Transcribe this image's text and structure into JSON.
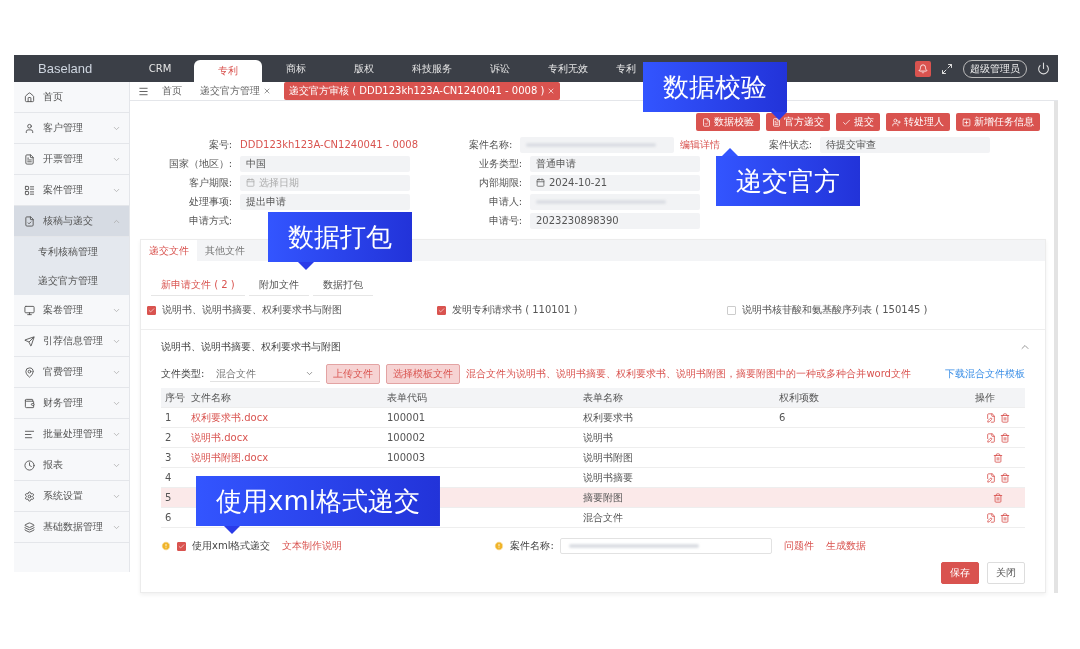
{
  "top_bar": {
    "logo": "Baseland",
    "nav": [
      {
        "label": "CRM",
        "selected": false
      },
      {
        "label": "专利",
        "selected": true
      },
      {
        "label": "商标",
        "selected": false
      },
      {
        "label": "版权",
        "selected": false
      },
      {
        "label": "科技服务",
        "selected": false
      },
      {
        "label": "诉讼",
        "selected": false
      },
      {
        "label": "专利无效",
        "selected": false
      },
      {
        "label": "专利",
        "selected": false
      }
    ],
    "user": "超级管理员"
  },
  "breadcrumbs": [
    {
      "label": "首页",
      "selected": false,
      "closable": false
    },
    {
      "label": "递交官方管理",
      "selected": false,
      "closable": true
    },
    {
      "label": "递交官方审核 ( DDD123kh123A-CN1240041 - 0008 )",
      "selected": true,
      "closable": true
    }
  ],
  "sidebar": {
    "items": [
      {
        "label": "首页",
        "kind": "link",
        "selected": false
      },
      {
        "label": "客户管理",
        "kind": "group",
        "selected": false,
        "expanded": false
      },
      {
        "label": "开票管理",
        "kind": "group",
        "selected": false,
        "expanded": false
      },
      {
        "label": "案件管理",
        "kind": "group",
        "selected": false,
        "expanded": false
      },
      {
        "label": "核稿与递交",
        "kind": "group",
        "selected": true,
        "expanded": true,
        "children": [
          {
            "label": "专利核稿管理",
            "selected": false
          },
          {
            "label": "递交官方管理",
            "selected": false
          }
        ]
      },
      {
        "label": "案卷管理",
        "kind": "group",
        "selected": false,
        "expanded": false
      },
      {
        "label": "引荐信息管理",
        "kind": "group",
        "selected": false,
        "expanded": false
      },
      {
        "label": "官费管理",
        "kind": "group",
        "selected": false,
        "expanded": false
      },
      {
        "label": "财务管理",
        "kind": "group",
        "selected": false,
        "expanded": false
      },
      {
        "label": "批量处理管理",
        "kind": "group",
        "selected": false,
        "expanded": false
      },
      {
        "label": "报表",
        "kind": "group",
        "selected": false,
        "expanded": false
      },
      {
        "label": "系统设置",
        "kind": "group",
        "selected": false,
        "expanded": false
      },
      {
        "label": "基础数据管理",
        "kind": "group",
        "selected": false,
        "expanded": false
      }
    ]
  },
  "actions": [
    "数据校验",
    "官方递交",
    "提交",
    "转处理人",
    "新增任务信息"
  ],
  "form": {
    "columns": [
      [
        {
          "label": "案号:",
          "kind": "plain",
          "value": "DDD123kh123A-CN1240041 - 0008"
        },
        {
          "label": "国家（地区）:",
          "kind": "input",
          "value": "中国"
        },
        {
          "label": "客户期限:",
          "kind": "date",
          "placeholder": "选择日期"
        },
        {
          "label": "处理事项:",
          "kind": "input",
          "value": "提出申请"
        },
        {
          "label": "申请方式:",
          "kind": "label"
        }
      ],
      [
        {
          "label": "案件名称:",
          "kind": "redacted",
          "link": "编辑详情"
        },
        {
          "label": "业务类型:",
          "kind": "input",
          "value": "普通申请"
        },
        {
          "label": "内部期限:",
          "kind": "date",
          "value": "2024-10-21"
        },
        {
          "label": "申请人:",
          "kind": "redacted"
        },
        {
          "label": "申请号:",
          "kind": "input",
          "value": "2023230898390"
        }
      ],
      [
        {
          "label": "案件状态:",
          "kind": "input",
          "value": "待提交审查"
        }
      ]
    ]
  },
  "tabs": [
    {
      "label": "递交文件",
      "selected": true
    },
    {
      "label": "其他文件",
      "selected": false
    }
  ],
  "subtabs": [
    {
      "label": "新申请文件 ( 2 )",
      "selected": true
    },
    {
      "label": "附加文件",
      "selected": false
    },
    {
      "label": "数据打包",
      "selected": false
    }
  ],
  "doc_types": [
    {
      "label": "说明书、说明书摘要、权利要求书与附图",
      "checked": true
    },
    {
      "label": "发明专利请求书 ( 110101 )",
      "checked": true
    },
    {
      "label": "说明书核苷酸和氨基酸序列表 ( 150145 )",
      "checked": false
    }
  ],
  "section": {
    "title": "说明书、说明书摘要、权利要求书与附图",
    "expanded": true
  },
  "file_type": {
    "label": "文件类型:",
    "value": "混合文件",
    "buttons": [
      "上传文件",
      "选择模板文件"
    ],
    "note": "混合文件为说明书、说明书摘要、权利要求书、说明书附图，摘要附图中的一种或多种合并word文件",
    "link": "下载混合文件模板"
  },
  "table": {
    "columns": [
      "序号",
      "文件名称",
      "表单代码",
      "表单名称",
      "权利项数",
      "操作"
    ],
    "rows": [
      {
        "no": "1",
        "file": "权利要求书.docx",
        "code": "100001",
        "form": "权利要求书",
        "claims": "6",
        "editable": true,
        "selected": false
      },
      {
        "no": "2",
        "file": "说明书.docx",
        "code": "100002",
        "form": "说明书",
        "editable": true,
        "selected": false
      },
      {
        "no": "3",
        "file": "说明书附图.docx",
        "code": "100003",
        "form": "说明书附图",
        "editable": false,
        "selected": false
      },
      {
        "no": "4",
        "form": "说明书摘要",
        "editable": true,
        "selected": false
      },
      {
        "no": "5",
        "form": "摘要附图",
        "editable": false,
        "selected": true
      },
      {
        "no": "6",
        "form": "混合文件",
        "editable": true,
        "selected": false
      }
    ]
  },
  "footer": {
    "xml": {
      "checked": true,
      "label": "使用xml格式递交",
      "link": "文本制作说明"
    },
    "case_name": {
      "label": "案件名称:"
    },
    "links": [
      "问题件",
      "生成数据"
    ],
    "buttons": [
      {
        "label": "保存",
        "kind": "primary"
      },
      {
        "label": "关闭",
        "kind": "plain"
      }
    ]
  },
  "callouts": [
    {
      "text": "数据校验"
    },
    {
      "text": "递交官方"
    },
    {
      "text": "数据打包"
    },
    {
      "text": "使用xml格式递交"
    }
  ]
}
